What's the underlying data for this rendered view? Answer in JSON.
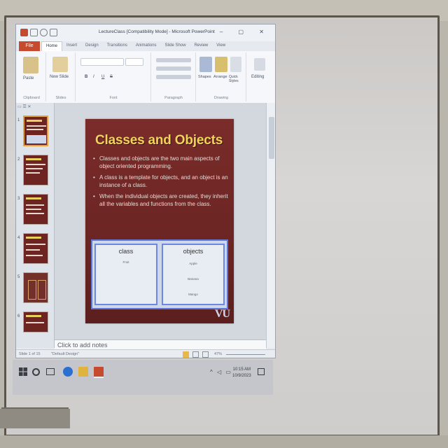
{
  "window": {
    "title": "LectureClass [Compatibility Mode] - Microsoft PowerPoint",
    "controls": "–  ▢  ✕",
    "file_tab": "File"
  },
  "ribbon": {
    "tabs": [
      "Home",
      "Insert",
      "Design",
      "Transitions",
      "Animations",
      "Slide Show",
      "Review",
      "View"
    ],
    "groups": {
      "clipboard": "Clipboard",
      "slides": "Slides",
      "font": "Font",
      "paragraph": "Paragraph",
      "drawing": "Drawing"
    },
    "buttons": {
      "paste": "Paste",
      "new_slide": "New Slide",
      "shapes": "Shapes",
      "arrange": "Arrange",
      "quick_styles": "Quick Styles",
      "editing": "Editing",
      "bold": "B",
      "italic": "I",
      "underline": "U",
      "strike": "S"
    }
  },
  "slide_panel": {
    "thumbs": [
      "1",
      "2",
      "3",
      "4",
      "5",
      "6"
    ]
  },
  "slide": {
    "title": "Classes and Objects",
    "bullets": [
      "Classes and objects are the two main aspects of object oriented programming.",
      "A class is a template for objects, and an object is an instance of a class.",
      "When the individual objects are created, they inherit all the variables and functions from the class."
    ],
    "diagram": {
      "left_heading": "class",
      "left_item": "Fruit",
      "right_heading": "objects",
      "right_items": [
        "Apple",
        "Banana",
        "Mango"
      ]
    },
    "logo": "VU"
  },
  "notes_placeholder": "Click to add notes",
  "status": {
    "slide_info": "Slide 1 of 15",
    "theme": "\"Default Design\"",
    "zoom": "47%"
  },
  "taskbar": {
    "time": "10:15 AM",
    "date": "10/9/2023"
  }
}
